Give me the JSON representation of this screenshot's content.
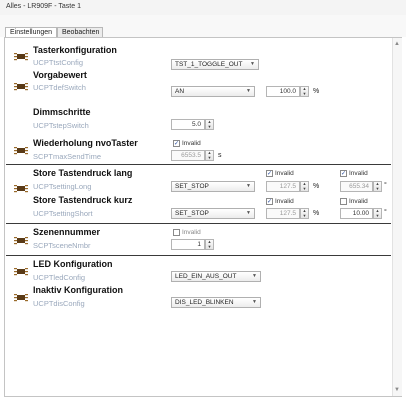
{
  "window": {
    "title": "Alles - LR909F - Taste 1"
  },
  "tabs": [
    {
      "label": "Einstellungen"
    },
    {
      "label": "Beobachten"
    }
  ],
  "sections": {
    "taster": {
      "title": "Tasterkonfiguration",
      "var": "UCPTtstConfig",
      "select": "TST_1_TOGGLE_OUT"
    },
    "vorgabe": {
      "title": "Vorgabewert",
      "var": "UCPTdefSwitch",
      "select": "AN",
      "value": "100.0",
      "unit": "%"
    },
    "dimm": {
      "title": "Dimmschritte",
      "var": "UCPTstepSwitch",
      "value": "5.0"
    },
    "wiederholung": {
      "title": "Wiederholung nvoTaster",
      "var": "SCPTmaxSendTime",
      "invalid_label": "Invalid",
      "value": "6553.5",
      "unit": "s"
    },
    "store_lang": {
      "title": "Store Tastendruck lang",
      "var": "UCPTsettingLong",
      "select": "SET_STOP",
      "invalid1": "Invalid",
      "value1": "127.5",
      "unit1": "%",
      "invalid2": "Invalid",
      "value2": "655.34",
      "unit2": "°"
    },
    "store_kurz": {
      "title": "Store Tastendruck kurz",
      "var": "UCPTsettingShort",
      "select": "SET_STOP",
      "invalid1": "Invalid",
      "value1": "127.5",
      "unit1": "%",
      "invalid2": "Invalid",
      "value2": "10.00",
      "unit2": "°"
    },
    "szene": {
      "title": "Szenennummer",
      "var": "SCPTsceneNmbr",
      "invalid_label": "Invalid",
      "value": "1"
    },
    "led": {
      "title": "LED Konfiguration",
      "var": "UCPTledConfig",
      "select": "LED_EIN_AUS_OUT"
    },
    "inaktiv": {
      "title": "Inaktiv Konfiguration",
      "var": "UCPTdisConfig",
      "select": "DIS_LED_BLINKEN"
    }
  }
}
